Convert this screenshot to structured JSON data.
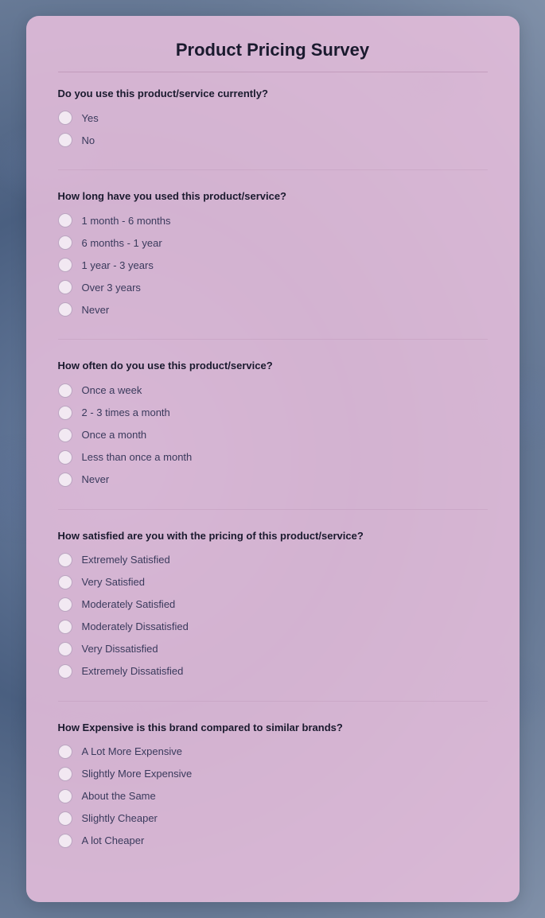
{
  "survey": {
    "title": "Product Pricing Survey",
    "sections": [
      {
        "id": "current-use",
        "question": "Do you use this product/service currently?",
        "options": [
          "Yes",
          "No"
        ]
      },
      {
        "id": "duration",
        "question": "How long have you used this product/service?",
        "options": [
          "1 month - 6 months",
          "6 months - 1 year",
          "1 year - 3 years",
          "Over 3 years",
          "Never"
        ]
      },
      {
        "id": "frequency",
        "question": "How often do you use this product/service?",
        "options": [
          "Once a week",
          "2 - 3 times a month",
          "Once a month",
          "Less than once a month",
          "Never"
        ]
      },
      {
        "id": "satisfaction",
        "question": "How satisfied are you with the pricing of this product/service?",
        "options": [
          "Extremely Satisfied",
          "Very Satisfied",
          "Moderately Satisfied",
          "Moderately Dissatisfied",
          "Very Dissatisfied",
          "Extremely Dissatisfied"
        ]
      },
      {
        "id": "comparison",
        "question": "How Expensive is this brand compared to similar brands?",
        "options": [
          "A Lot More Expensive",
          "Slightly More Expensive",
          "About the Same",
          "Slightly Cheaper",
          "A lot Cheaper"
        ]
      }
    ]
  }
}
